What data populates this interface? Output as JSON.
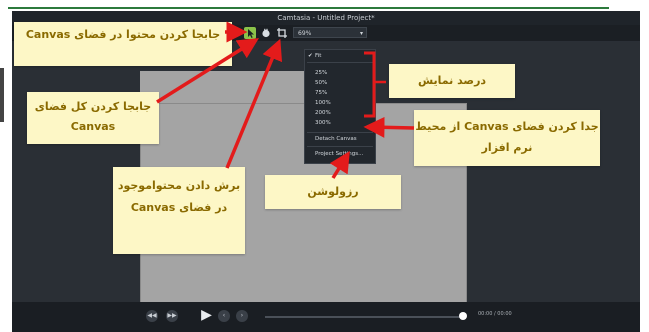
{
  "app": {
    "window_title": "Camtasia - Untitled Project*",
    "zoom_value": "69%",
    "zoom_menu": {
      "fit_label": "Fit",
      "percent_items": [
        "25%",
        "50%",
        "75%",
        "100%",
        "200%",
        "300%"
      ],
      "detach_label": "Detach Canvas",
      "project_settings_label": "Project Settings..."
    },
    "playback": {
      "time_display": "00:00 / 00:00"
    }
  },
  "annotations": {
    "move_content": "جابجا کردن محتوا در فضای Canvas",
    "move_canvas": "جابجا کردن کل فضای Canvas",
    "crop_content": "برش دادن محتواموجود در فضای Canvas",
    "zoom_percent": "درصد نمایش",
    "detach_canvas": "جدا کردن فضای Canvas از محیط نرم افزار",
    "resolution": "رزولوشن"
  },
  "colors": {
    "accent_red": "#e31b1b",
    "callout_bg": "#fdf7c6",
    "callout_text": "#8a6a00"
  }
}
